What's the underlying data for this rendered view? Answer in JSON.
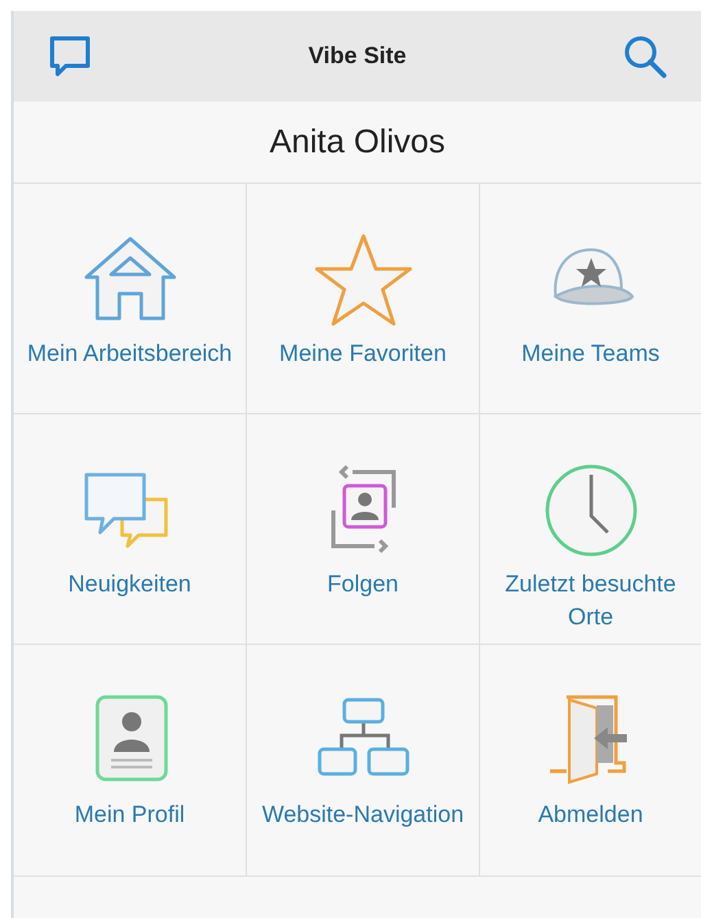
{
  "header": {
    "title": "Vibe Site"
  },
  "user": {
    "name": "Anita Olivos"
  },
  "tiles": [
    {
      "kind": "home",
      "label": "Mein Arbeitsbereich"
    },
    {
      "kind": "star",
      "label": "Meine Favoriten"
    },
    {
      "kind": "cap",
      "label": "Meine Teams"
    },
    {
      "kind": "chat",
      "label": "Neuigkeiten"
    },
    {
      "kind": "follow",
      "label": "Folgen"
    },
    {
      "kind": "clock",
      "label": "Zuletzt besuchte Orte"
    },
    {
      "kind": "profile",
      "label": "Mein Profil"
    },
    {
      "kind": "sitemap",
      "label": "Website-Navigation"
    },
    {
      "kind": "logout",
      "label": "Abmelden"
    }
  ]
}
